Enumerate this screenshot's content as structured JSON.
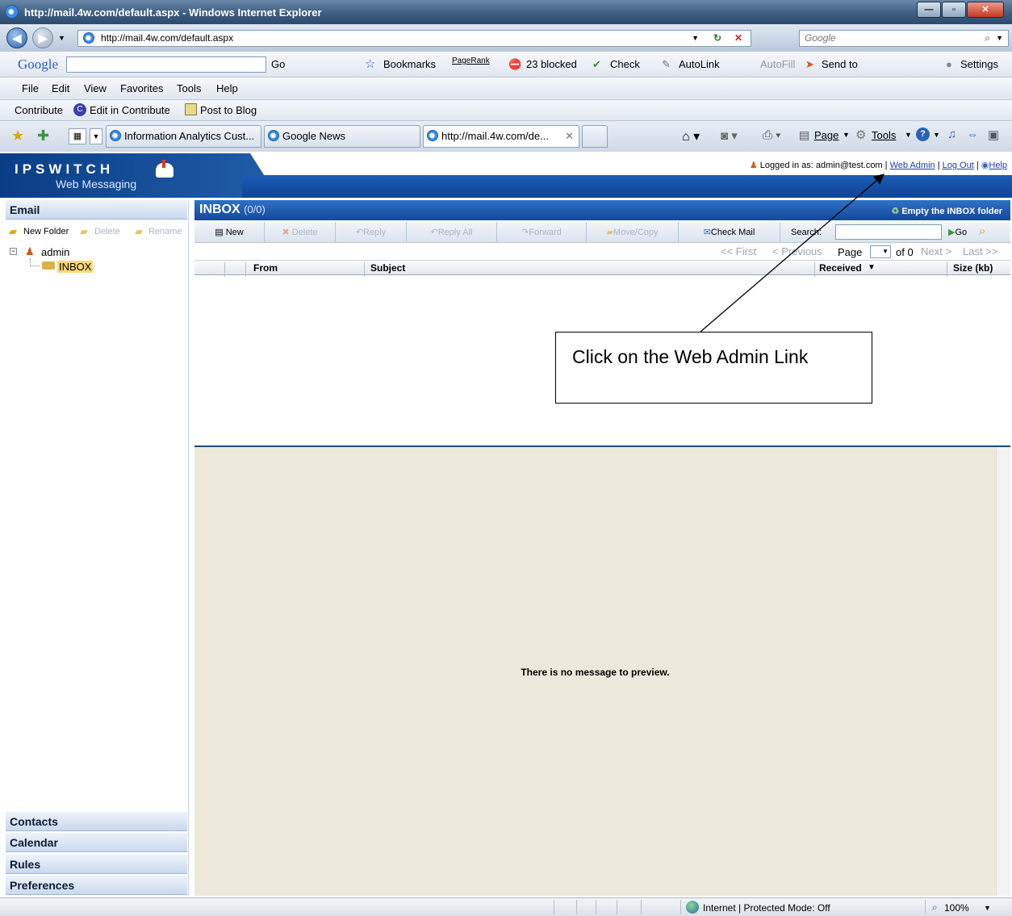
{
  "window": {
    "title": "http://mail.4w.com/default.aspx - Windows Internet Explorer"
  },
  "address": {
    "url": "http://mail.4w.com/default.aspx",
    "search_placeholder": "Google"
  },
  "google_toolbar": {
    "brand": "Google",
    "go": "Go",
    "bookmarks": "Bookmarks",
    "pagerank": "PageRank",
    "blocked": "23 blocked",
    "check": "Check",
    "autolink": "AutoLink",
    "autofill": "AutoFill",
    "sendto": "Send to",
    "settings": "Settings"
  },
  "menu": [
    "File",
    "Edit",
    "View",
    "Favorites",
    "Tools",
    "Help"
  ],
  "contribute": {
    "label": "Contribute",
    "edit": "Edit in Contribute",
    "post": "Post to Blog"
  },
  "tabs": [
    "Information Analytics Cust...",
    "Google News",
    "http://mail.4w.com/de..."
  ],
  "command_bar": {
    "page": "Page",
    "tools": "Tools"
  },
  "app": {
    "brand": "IPSWITCH",
    "subbrand": "Web Messaging",
    "logged_in_label": "Logged in as:",
    "user": "admin@test.com",
    "web_admin": "Web Admin",
    "log_out": "Log Out",
    "help": "Help"
  },
  "sidebar": {
    "email": "Email",
    "new_folder": "New Folder",
    "delete": "Delete",
    "rename": "Rename",
    "tree_root": "admin",
    "tree_inbox": "INBOX",
    "sections": [
      "Contacts",
      "Calendar",
      "Rules",
      "Preferences"
    ]
  },
  "main": {
    "folder": "INBOX",
    "count": "(0/0)",
    "empty_folder": "Empty the INBOX folder",
    "toolbar": {
      "new": "New",
      "delete": "Delete",
      "reply": "Reply",
      "reply_all": "Reply All",
      "forward": "Forward",
      "move_copy": "Move/Copy",
      "check_mail": "Check Mail",
      "search": "Search:",
      "go": "Go"
    },
    "pager": {
      "first": "<< First",
      "previous": "< Previous",
      "page": "Page",
      "of": "of 0",
      "next": "Next >",
      "last": "Last >>"
    },
    "columns": {
      "from": "From",
      "subject": "Subject",
      "received": "Received",
      "size": "Size (kb)"
    },
    "preview_empty": "There is no message to preview."
  },
  "callout": "Click on the Web Admin Link",
  "status": {
    "zone": "Internet | Protected Mode: Off",
    "zoom": "100%"
  }
}
